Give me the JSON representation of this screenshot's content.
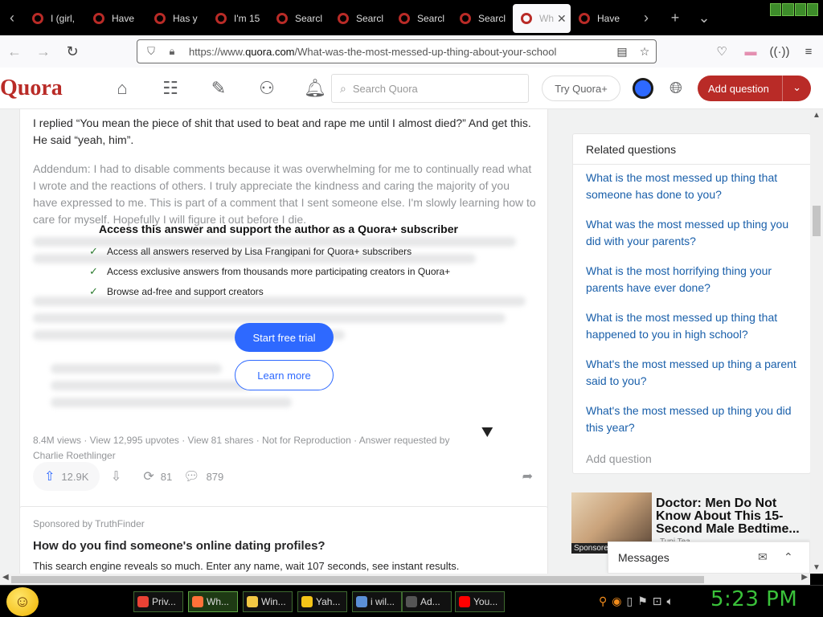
{
  "browser": {
    "tabs": [
      {
        "label": "I (girl,"
      },
      {
        "label": "Have"
      },
      {
        "label": "Has y"
      },
      {
        "label": "I'm 15"
      },
      {
        "label": "Searcl"
      },
      {
        "label": "Searcl"
      },
      {
        "label": "Searcl"
      },
      {
        "label": "Searcl"
      },
      {
        "label": "Wh"
      },
      {
        "label": "Have"
      }
    ],
    "active_tab_index": 8,
    "url_prefix": "https://www.",
    "url_domain": "quora.com",
    "url_path": "/What-was-the-most-messed-up-thing-about-your-school"
  },
  "quora": {
    "logo": "Quora",
    "search_placeholder": "Search Quora",
    "try_plus": "Try Quora+",
    "add_question": "Add question",
    "brand_color": "#b92b27",
    "accent_color": "#2e69ff"
  },
  "answer": {
    "para1": "I replied “You mean the piece of shit that used to beat and rape me until I almost died?” And get this. He said “yeah, him”.",
    "para2": "Addendum: I had to disable comments because it was overwhelming for me to continually read what I wrote and the reactions of others. I truly appreciate the kindness and caring the majority of you have expressed to me. This is part of a comment that I sent someone else. I'm slowly learning how to care for myself. Hopefully I will figure it out before I die.",
    "paywall_title": "Access this answer and support the author as a Quora+ subscriber",
    "benefits": [
      "Access all answers reserved by Lisa Frangipani for Quora+ subscribers",
      "Access exclusive answers from thousands more participating creators in Quora+",
      "Browse ad-free and support creators"
    ],
    "start_trial": "Start free trial",
    "learn_more": "Learn more",
    "meta_line1": "8.4M views · View 12,995 upvotes · View 81 shares · Not for Reproduction · Answer requested by",
    "meta_line2": "Charlie Roethlinger",
    "upvotes": "12.9K",
    "shares": "81",
    "comments": "879"
  },
  "sponsored": {
    "by": "Sponsored by TruthFinder",
    "title": "How do you find someone's online dating profiles?",
    "desc": "This search engine reveals so much. Enter any name, wait 107 seconds, see instant results."
  },
  "related": {
    "header": "Related questions",
    "items": [
      "What is the most messed up thing that someone has done to you?",
      "What was the most messed up thing you did with your parents?",
      "What is the most horrifying thing your parents have ever done?",
      "What is the most messed up thing that happened to you in high school?",
      "What's the most messed up thing a parent said to you?",
      "What's the most messed up thing you did this year?"
    ],
    "add_question": "Add question"
  },
  "ad": {
    "title": "Doctor: Men Do Not Know About This 15-Second Male Bedtime...",
    "label": "Sponsore",
    "source": "Tupi Tea"
  },
  "messages": {
    "label": "Messages"
  },
  "taskbar": {
    "tasks": [
      {
        "label": "Priv...",
        "color": "#e94235"
      },
      {
        "label": "Wh...",
        "color": "#ff7139"
      },
      {
        "label": "Win...",
        "color": "#f2c744"
      },
      {
        "label": "Yah...",
        "color": "#f5c518"
      },
      {
        "label": "i wil...",
        "color": "#5b8fd6"
      },
      {
        "label": "Ad...",
        "color": "#555555"
      },
      {
        "label": "You...",
        "color": "#ff0000"
      }
    ],
    "clock": "5:23 PM"
  }
}
